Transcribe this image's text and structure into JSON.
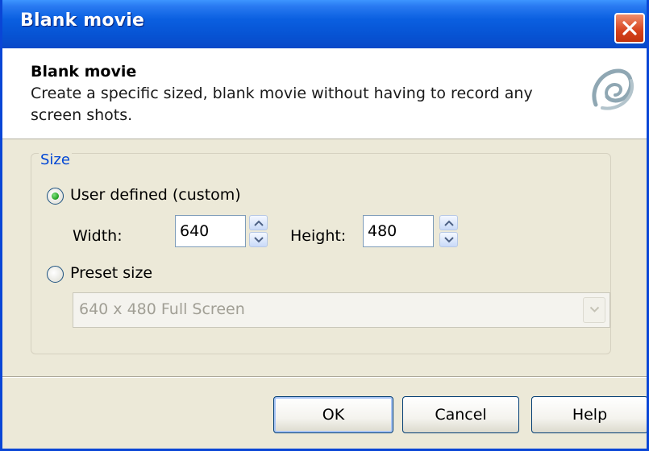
{
  "window": {
    "title": "Blank movie"
  },
  "header": {
    "title": "Blank movie",
    "description": "Create a specific sized, blank movie without having to record any screen shots."
  },
  "size_group": {
    "legend": "Size",
    "user_defined": {
      "label": "User defined (custom)",
      "selected": true,
      "width_label": "Width:",
      "width_value": "640",
      "height_label": "Height:",
      "height_value": "480"
    },
    "preset": {
      "label": "Preset size",
      "selected": false,
      "value": "640 x 480 Full Screen",
      "enabled": false
    }
  },
  "buttons": {
    "ok": "OK",
    "cancel": "Cancel",
    "help": "Help"
  },
  "colors": {
    "title_bar": "#0754d4",
    "group_legend": "#0046d5",
    "dialog_bg": "#ece9d8",
    "close_button": "#d6421c"
  }
}
